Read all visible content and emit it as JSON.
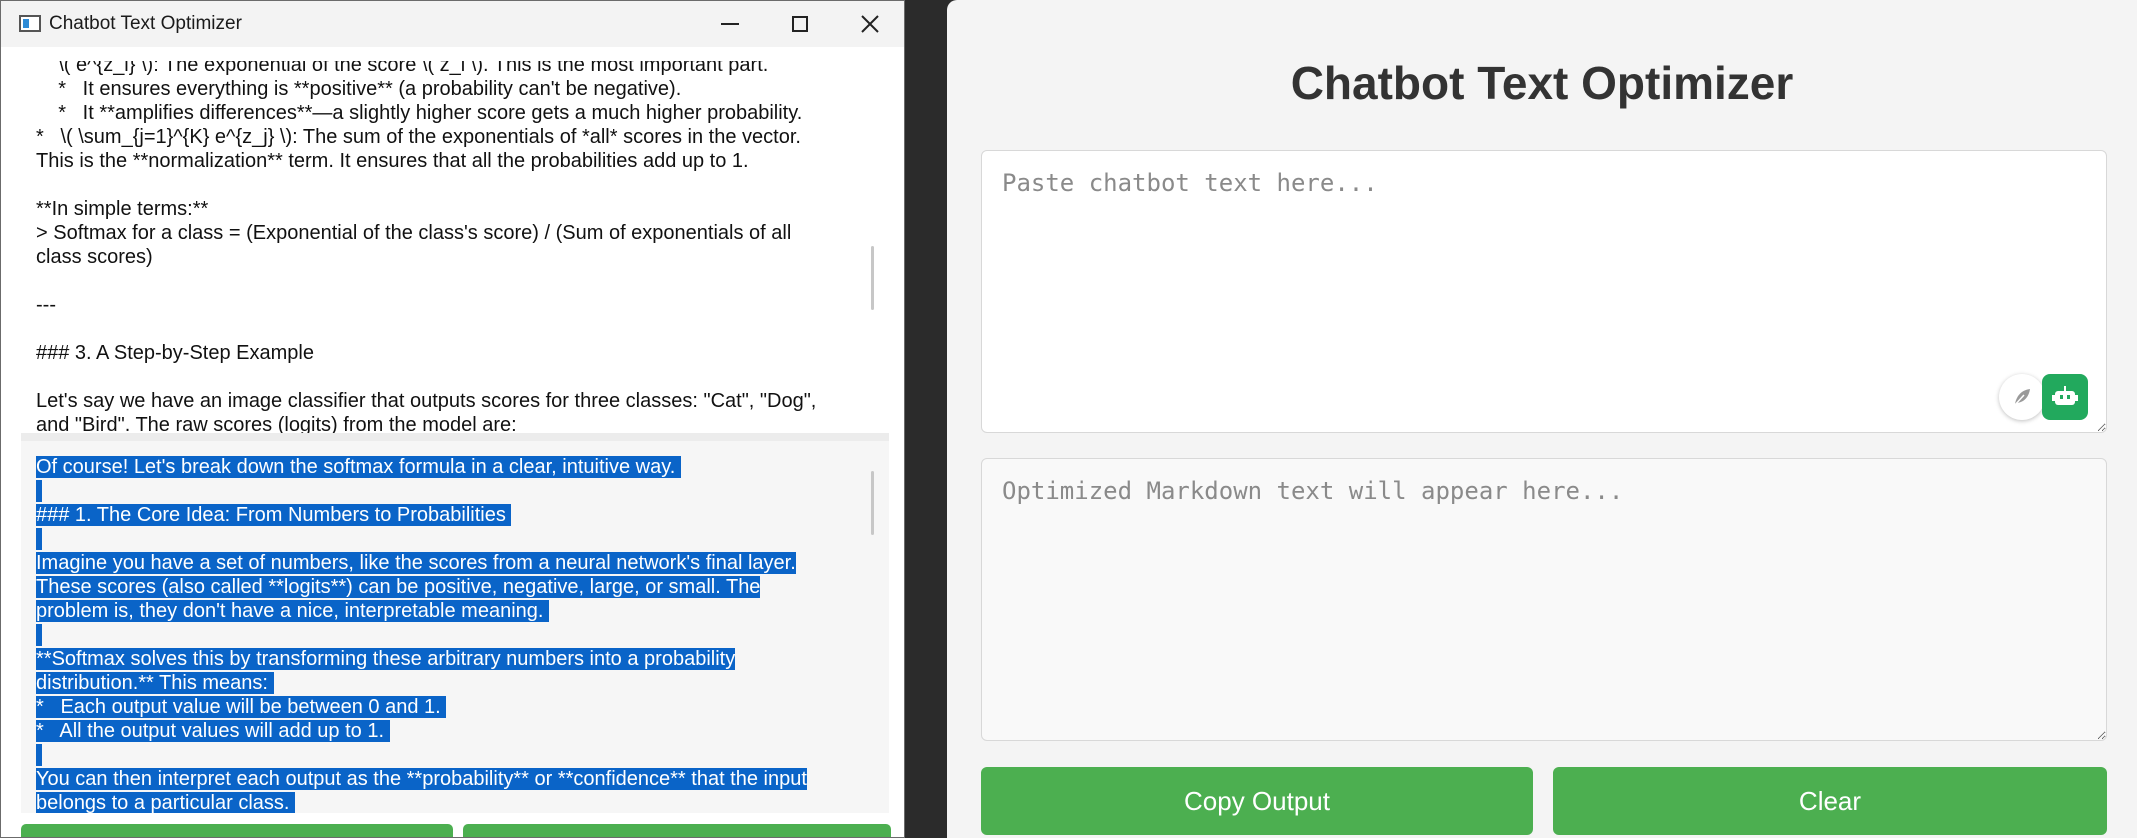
{
  "window": {
    "title": "Chatbot Text Optimizer",
    "top_pane_lines": [
      "    \\( e^{z_i} \\): The exponential of the score \\( z_i \\). This is the most important part.",
      "    *   It ensures everything is **positive** (a probability can't be negative).",
      "    *   It **amplifies differences**—a slightly higher score gets a much higher probability.",
      "*   \\( \\sum_{j=1}^{K} e^{z_j} \\): The sum of the exponentials of *all* scores in the vector.",
      "This is the **normalization** term. It ensures that all the probabilities add up to 1.",
      "",
      "**In simple terms:**",
      "> Softmax for a class = (Exponential of the class's score) / (Sum of exponentials of all",
      "class scores)",
      "",
      "---",
      "",
      "### 3. A Step-by-Step Example",
      "",
      "Let's say we have an image classifier that outputs scores for three classes: \"Cat\", \"Dog\",",
      "and \"Bird\". The raw scores (logits) from the model are:"
    ],
    "bottom_pane_lines": [
      "Of course! Let's break down the softmax formula in a clear, intuitive way. ",
      " ",
      "### 1. The Core Idea: From Numbers to Probabilities ",
      " ",
      "Imagine you have a set of numbers, like the scores from a neural network's final layer.",
      "These scores (also called **logits**) can be positive, negative, large, or small. The",
      "problem is, they don't have a nice, interpretable meaning. ",
      " ",
      "**Softmax solves this by transforming these arbitrary numbers into a probability",
      "distribution.** This means: ",
      "*   Each output value will be between 0 and 1. ",
      "*   All the output values will add up to 1. ",
      " ",
      "You can then interpret each output as the **probability** or **confidence** that the input",
      "belongs to a particular class. "
    ]
  },
  "app": {
    "title": "Chatbot Text Optimizer",
    "input_placeholder": "Paste chatbot text here...",
    "output_placeholder": "Optimized Markdown text will appear here...",
    "copy_button": "Copy Output",
    "clear_button": "Clear",
    "accent_color": "#4caf50"
  }
}
